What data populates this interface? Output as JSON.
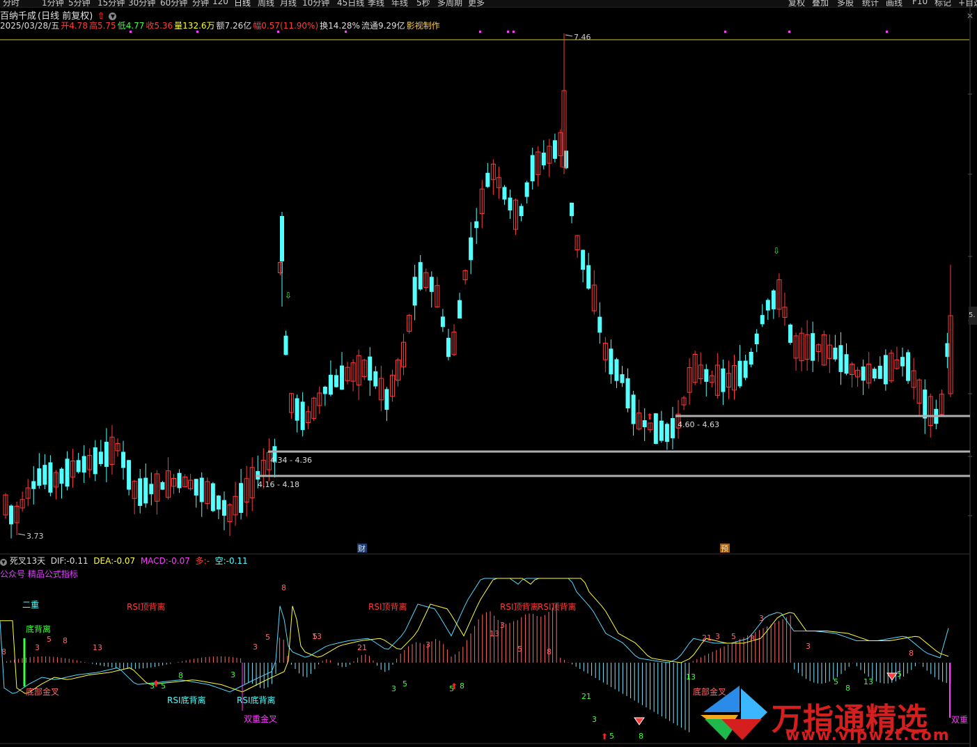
{
  "toolbar": {
    "left_tabs": [
      "分时",
      "1分钟",
      "5分钟",
      "15分钟",
      "30分钟",
      "60分钟",
      "分钟",
      "120",
      "日线",
      "周线",
      "月线",
      "10分钟",
      "45日线",
      "季线",
      "年线",
      "5秒",
      "多周期",
      "更多"
    ],
    "active_tab": "日线",
    "right_tabs": [
      "复权",
      "叠加",
      "多股",
      "统计",
      "画线",
      "F10",
      "标记",
      "+自选"
    ]
  },
  "title": {
    "stock_name": "百纳千成",
    "period_label": "(日线 前复权)"
  },
  "info": {
    "date": "2025/03/28/五",
    "open_label": "开",
    "open": "4.78",
    "high_label": "高",
    "high": "5.75",
    "low_label": "低",
    "low": "4.77",
    "close_label": "收",
    "close": "5.36",
    "volume_label": "量",
    "volume": "132.6万",
    "amount_label": "额",
    "amount": "7.26亿",
    "change_label": "幅",
    "change": "0.57(11.90%)",
    "turnover_label": "换",
    "turnover": "14.28%",
    "float_label": "流通",
    "float": "9.29亿",
    "credit": "影视制作"
  },
  "price_marks": {
    "high_mark": "7.46",
    "low_mark": "3.73",
    "right_label": "5."
  },
  "support_levels": [
    "4.60 - 4.63",
    "4.34 - 4.36",
    "4.16 - 4.18"
  ],
  "event_markers": {
    "finance": "财",
    "forecast": "预"
  },
  "indicator": {
    "name": "死叉13天",
    "dif_label": "DIF:",
    "dif": "-0.11",
    "dea_label": "DEA:",
    "dea": "-0.07",
    "macd_label": "MACD:",
    "macd": "-0.07",
    "duo_label": "多:",
    "duo": "-",
    "kong_label": "空:",
    "kong": "-0.11",
    "subtitle": "公众号 精品公式指标"
  },
  "indicator_labels": {
    "erzhong": "二重",
    "dibeili": "底背离",
    "dibujincha": "底部金叉",
    "rsi_top_1": "RSI顶背离",
    "rsi_top_2": "RSI顶背离",
    "rsi_top_3": "RSI顶背离",
    "rsi_top_4": "RSI顶背离",
    "rsi_bottom_1": "RSI底背离",
    "rsi_bottom_2": "RSI底背离",
    "shuangzhong_1": "双重金叉",
    "shuangzhong_2": "双重",
    "dibujincha_2": "底部金叉"
  },
  "count_numbers": [
    "8",
    "3",
    "5",
    "8",
    "13",
    "8",
    "3",
    "5",
    "3",
    "5",
    "8",
    "3",
    "5",
    "13",
    "21",
    "3",
    "5",
    "3",
    "5",
    "8",
    "13",
    "3",
    "5",
    "8",
    "21",
    "3",
    "5",
    "8",
    "13",
    "21",
    "3",
    "5",
    "8",
    "3",
    "3",
    "5",
    "8",
    "13",
    "5",
    "8"
  ],
  "watermark": {
    "text": "万指通精选",
    "url": "www.vipwzt.com"
  },
  "colors": {
    "up": "#ff3b3b",
    "down": "#54ffff",
    "dif_line": "#ffffff",
    "dea_line": "#ffff33",
    "level_line": "#b0b0b0",
    "top_line": "#cccc33",
    "accent_magenta": "#ff3cff",
    "watermark": "#d51f1f"
  }
}
